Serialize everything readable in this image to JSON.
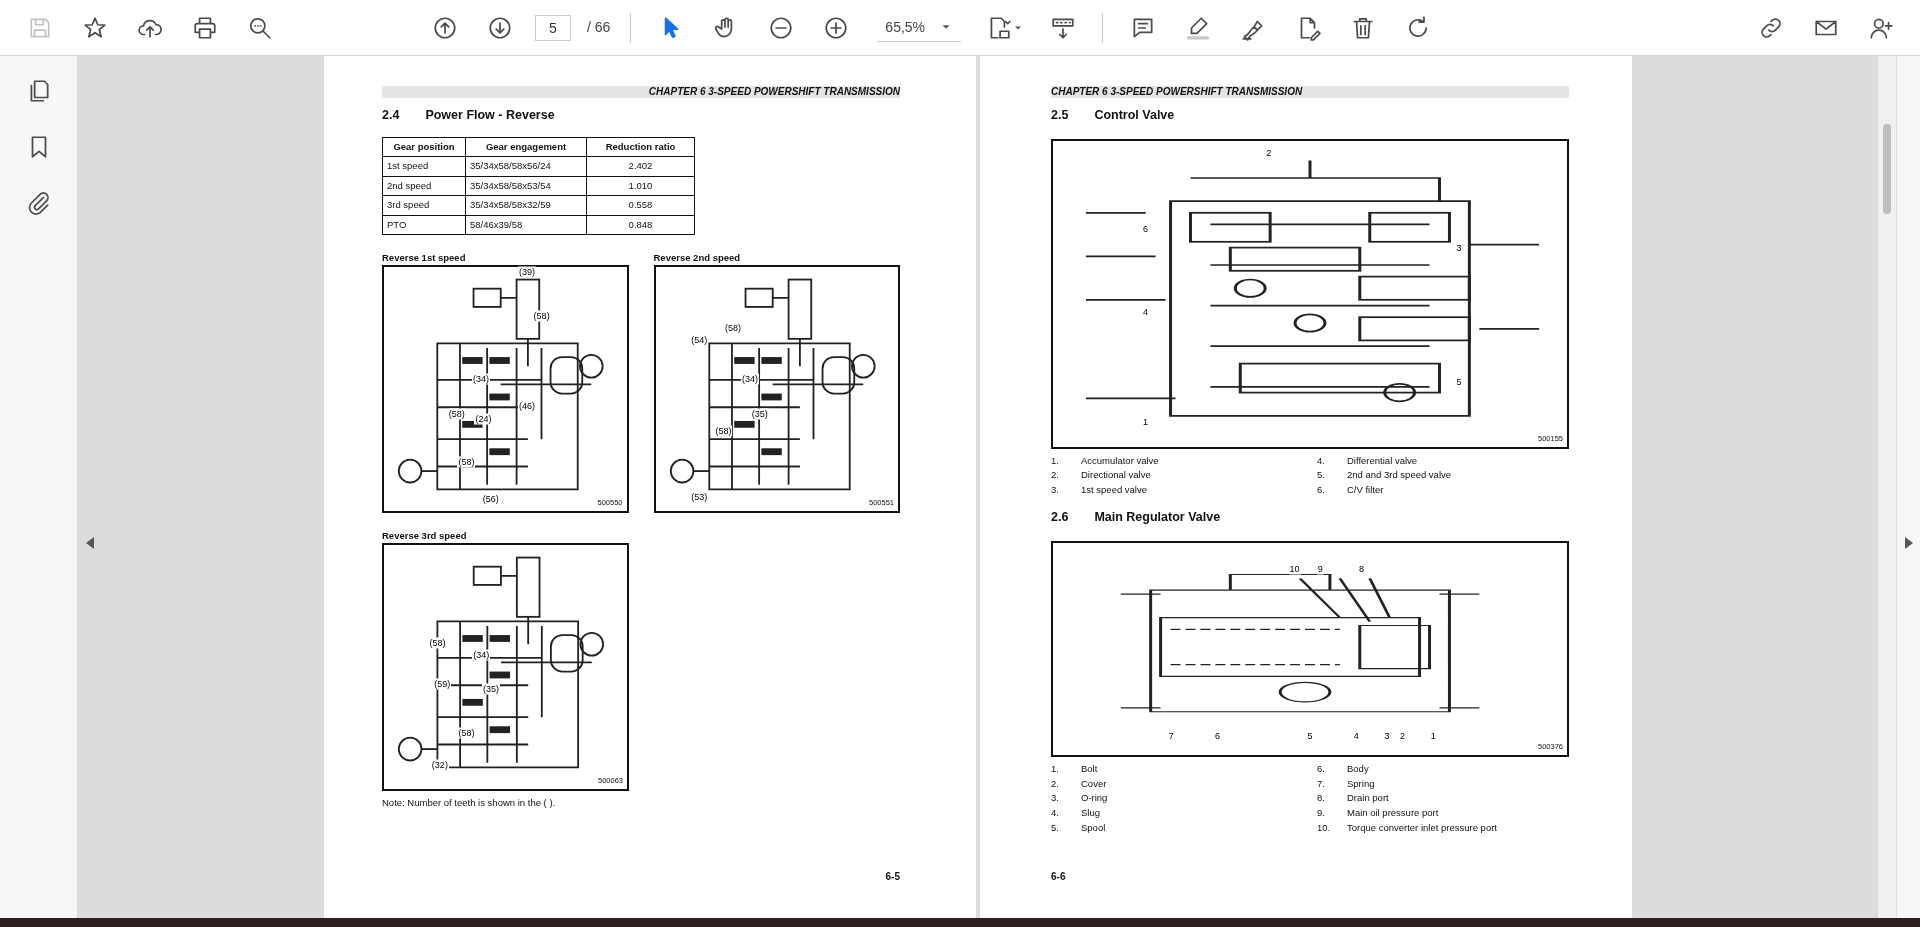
{
  "toolbar": {
    "page_current": "5",
    "page_total": "/ 66",
    "zoom": "65,5%",
    "save_disabled": true
  },
  "left_page": {
    "header": "CHAPTER 6 3-SPEED POWERSHIFT TRANSMISSION",
    "section": {
      "number": "2.4",
      "title": "Power Flow - Reverse"
    },
    "table": {
      "columns": [
        "Gear position",
        "Gear engagement",
        "Reduction ratio"
      ],
      "rows": [
        [
          "1st speed",
          "35/34x58/58x56/24",
          "2.402"
        ],
        [
          "2nd speed",
          "35/34x58/58x53/54",
          "1.010"
        ],
        [
          "3rd speed",
          "35/34x58/58x32/59",
          "0.558"
        ],
        [
          "PTO",
          "58/46x39/58",
          "0.848"
        ]
      ]
    },
    "figures": [
      {
        "title": "Reverse 1st speed",
        "code": "500550",
        "labels": [
          "(39)",
          "(58)",
          "(34)",
          "(24)",
          "(46)",
          "(58)",
          "(58)",
          "(56)"
        ]
      },
      {
        "title": "Reverse 2nd speed",
        "code": "500551",
        "labels": [
          "(58)",
          "(54)",
          "(34)",
          "(35)",
          "(58)",
          "(53)"
        ]
      },
      {
        "title": "Reverse 3rd speed",
        "code": "500063",
        "labels": [
          "(58)",
          "(34)",
          "(35)",
          "(59)",
          "(58)",
          "(32)"
        ]
      }
    ],
    "note": "Note: Number of teeth is shown in the (  ).",
    "page_number": "6-5"
  },
  "right_page": {
    "header": "CHAPTER 6 3-SPEED POWERSHIFT TRANSMISSION",
    "sections": [
      {
        "number": "2.5",
        "title": "Control Valve",
        "figure": {
          "kind": "control",
          "code": "500155",
          "callouts": [
            "2",
            "6",
            "3",
            "4",
            "5",
            "1"
          ]
        },
        "legend": [
          {
            "num": "1.",
            "text": "Accumulator valve"
          },
          {
            "num": "2.",
            "text": "Directional valve"
          },
          {
            "num": "3.",
            "text": "1st speed valve"
          },
          {
            "num": "4.",
            "text": "Differential valve"
          },
          {
            "num": "5.",
            "text": "2nd and 3rd speed valve"
          },
          {
            "num": "6.",
            "text": "C/V filter"
          }
        ]
      },
      {
        "number": "2.6",
        "title": "Main Regulator Valve",
        "figure": {
          "kind": "regulator",
          "code": "500376",
          "callouts": [
            "10",
            "9",
            "8",
            "7",
            "6",
            "5",
            "4",
            "3",
            "2",
            "1"
          ]
        },
        "legend": [
          {
            "num": "1.",
            "text": "Bolt"
          },
          {
            "num": "2.",
            "text": "Cover"
          },
          {
            "num": "3.",
            "text": "O-ring"
          },
          {
            "num": "4.",
            "text": "Slug"
          },
          {
            "num": "5.",
            "text": "Spool"
          },
          {
            "num": "6.",
            "text": "Body"
          },
          {
            "num": "7.",
            "text": "Spring"
          },
          {
            "num": "8.",
            "text": "Drain port"
          },
          {
            "num": "9.",
            "text": "Main oil pressure port"
          },
          {
            "num": "10.",
            "text": "Torque converter inlet pressure port"
          }
        ]
      }
    ],
    "page_number": "6-6"
  }
}
